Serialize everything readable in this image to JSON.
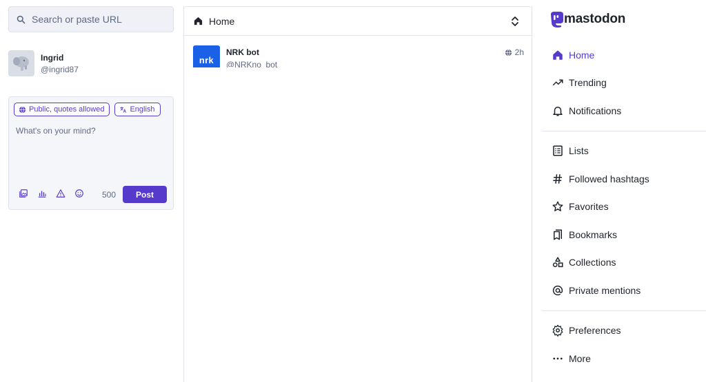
{
  "search": {
    "placeholder": "Search or paste URL",
    "icon": "search-icon"
  },
  "account": {
    "display_name": "Ingrid",
    "handle": "@ingrid87"
  },
  "composer": {
    "visibility_label": "Public, quotes allowed",
    "language_label": "English",
    "placeholder": "What's on your mind?",
    "char_count": "500",
    "post_label": "Post",
    "tools": [
      "media-icon",
      "poll-icon",
      "content-warning-icon",
      "emoji-icon"
    ]
  },
  "column": {
    "title": "Home"
  },
  "statuses": [
    {
      "avatar_text": "nrk",
      "display_name": "NRK bot",
      "handle": "@NRKno_bot",
      "time": "2h"
    }
  ],
  "brand": {
    "name": "mastodon"
  },
  "nav": {
    "home": "Home",
    "trending": "Trending",
    "notifications": "Notifications",
    "lists": "Lists",
    "followed_hashtags": "Followed hashtags",
    "favorites": "Favorites",
    "bookmarks": "Bookmarks",
    "collections": "Collections",
    "private_mentions": "Private mentions",
    "preferences": "Preferences",
    "more": "More"
  },
  "colors": {
    "accent": "#563acc",
    "text": "#1f232b",
    "muted": "#606984",
    "border": "#dfe2ea",
    "nrk_blue": "#1a61e8"
  }
}
